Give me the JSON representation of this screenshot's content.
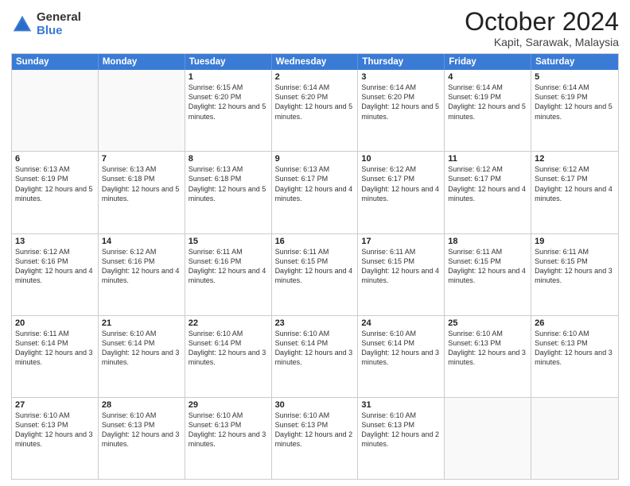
{
  "header": {
    "logo": {
      "general": "General",
      "blue": "Blue"
    },
    "title": "October 2024",
    "subtitle": "Kapit, Sarawak, Malaysia"
  },
  "calendar": {
    "days": [
      "Sunday",
      "Monday",
      "Tuesday",
      "Wednesday",
      "Thursday",
      "Friday",
      "Saturday"
    ],
    "weeks": [
      [
        {
          "day": "",
          "text": ""
        },
        {
          "day": "",
          "text": ""
        },
        {
          "day": "1",
          "text": "Sunrise: 6:15 AM\nSunset: 6:20 PM\nDaylight: 12 hours and 5 minutes."
        },
        {
          "day": "2",
          "text": "Sunrise: 6:14 AM\nSunset: 6:20 PM\nDaylight: 12 hours and 5 minutes."
        },
        {
          "day": "3",
          "text": "Sunrise: 6:14 AM\nSunset: 6:20 PM\nDaylight: 12 hours and 5 minutes."
        },
        {
          "day": "4",
          "text": "Sunrise: 6:14 AM\nSunset: 6:19 PM\nDaylight: 12 hours and 5 minutes."
        },
        {
          "day": "5",
          "text": "Sunrise: 6:14 AM\nSunset: 6:19 PM\nDaylight: 12 hours and 5 minutes."
        }
      ],
      [
        {
          "day": "6",
          "text": "Sunrise: 6:13 AM\nSunset: 6:19 PM\nDaylight: 12 hours and 5 minutes."
        },
        {
          "day": "7",
          "text": "Sunrise: 6:13 AM\nSunset: 6:18 PM\nDaylight: 12 hours and 5 minutes."
        },
        {
          "day": "8",
          "text": "Sunrise: 6:13 AM\nSunset: 6:18 PM\nDaylight: 12 hours and 5 minutes."
        },
        {
          "day": "9",
          "text": "Sunrise: 6:13 AM\nSunset: 6:17 PM\nDaylight: 12 hours and 4 minutes."
        },
        {
          "day": "10",
          "text": "Sunrise: 6:12 AM\nSunset: 6:17 PM\nDaylight: 12 hours and 4 minutes."
        },
        {
          "day": "11",
          "text": "Sunrise: 6:12 AM\nSunset: 6:17 PM\nDaylight: 12 hours and 4 minutes."
        },
        {
          "day": "12",
          "text": "Sunrise: 6:12 AM\nSunset: 6:17 PM\nDaylight: 12 hours and 4 minutes."
        }
      ],
      [
        {
          "day": "13",
          "text": "Sunrise: 6:12 AM\nSunset: 6:16 PM\nDaylight: 12 hours and 4 minutes."
        },
        {
          "day": "14",
          "text": "Sunrise: 6:12 AM\nSunset: 6:16 PM\nDaylight: 12 hours and 4 minutes."
        },
        {
          "day": "15",
          "text": "Sunrise: 6:11 AM\nSunset: 6:16 PM\nDaylight: 12 hours and 4 minutes."
        },
        {
          "day": "16",
          "text": "Sunrise: 6:11 AM\nSunset: 6:15 PM\nDaylight: 12 hours and 4 minutes."
        },
        {
          "day": "17",
          "text": "Sunrise: 6:11 AM\nSunset: 6:15 PM\nDaylight: 12 hours and 4 minutes."
        },
        {
          "day": "18",
          "text": "Sunrise: 6:11 AM\nSunset: 6:15 PM\nDaylight: 12 hours and 4 minutes."
        },
        {
          "day": "19",
          "text": "Sunrise: 6:11 AM\nSunset: 6:15 PM\nDaylight: 12 hours and 3 minutes."
        }
      ],
      [
        {
          "day": "20",
          "text": "Sunrise: 6:11 AM\nSunset: 6:14 PM\nDaylight: 12 hours and 3 minutes."
        },
        {
          "day": "21",
          "text": "Sunrise: 6:10 AM\nSunset: 6:14 PM\nDaylight: 12 hours and 3 minutes."
        },
        {
          "day": "22",
          "text": "Sunrise: 6:10 AM\nSunset: 6:14 PM\nDaylight: 12 hours and 3 minutes."
        },
        {
          "day": "23",
          "text": "Sunrise: 6:10 AM\nSunset: 6:14 PM\nDaylight: 12 hours and 3 minutes."
        },
        {
          "day": "24",
          "text": "Sunrise: 6:10 AM\nSunset: 6:14 PM\nDaylight: 12 hours and 3 minutes."
        },
        {
          "day": "25",
          "text": "Sunrise: 6:10 AM\nSunset: 6:13 PM\nDaylight: 12 hours and 3 minutes."
        },
        {
          "day": "26",
          "text": "Sunrise: 6:10 AM\nSunset: 6:13 PM\nDaylight: 12 hours and 3 minutes."
        }
      ],
      [
        {
          "day": "27",
          "text": "Sunrise: 6:10 AM\nSunset: 6:13 PM\nDaylight: 12 hours and 3 minutes."
        },
        {
          "day": "28",
          "text": "Sunrise: 6:10 AM\nSunset: 6:13 PM\nDaylight: 12 hours and 3 minutes."
        },
        {
          "day": "29",
          "text": "Sunrise: 6:10 AM\nSunset: 6:13 PM\nDaylight: 12 hours and 3 minutes."
        },
        {
          "day": "30",
          "text": "Sunrise: 6:10 AM\nSunset: 6:13 PM\nDaylight: 12 hours and 2 minutes."
        },
        {
          "day": "31",
          "text": "Sunrise: 6:10 AM\nSunset: 6:13 PM\nDaylight: 12 hours and 2 minutes."
        },
        {
          "day": "",
          "text": ""
        },
        {
          "day": "",
          "text": ""
        }
      ]
    ]
  }
}
